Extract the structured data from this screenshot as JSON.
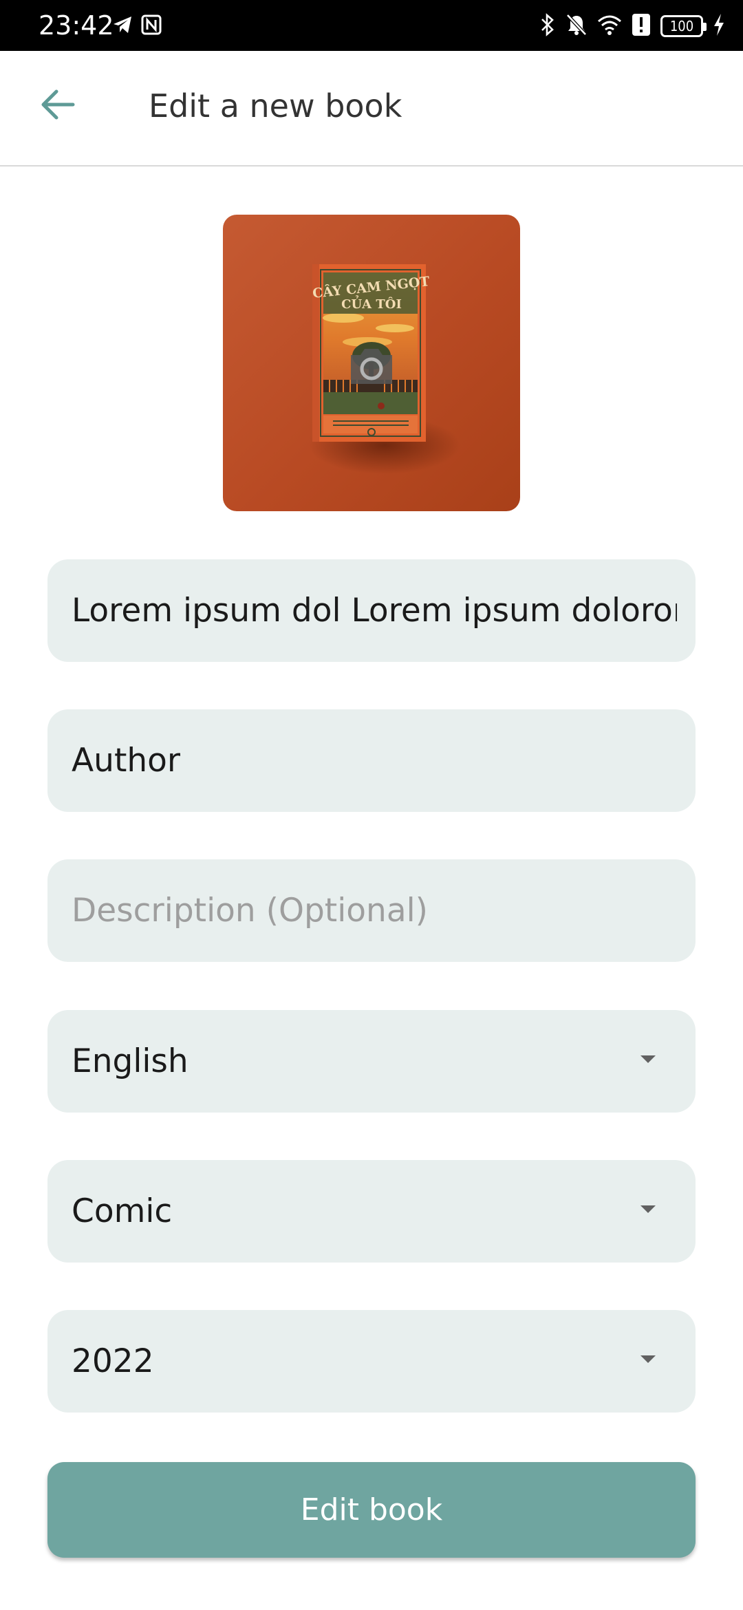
{
  "status_bar": {
    "time": "23:42",
    "battery": "100",
    "left_icons": [
      "telegram-icon",
      "nfc-icon"
    ],
    "right_icons": [
      "bluetooth-icon",
      "bell-off-icon",
      "wifi-icon",
      "alert-icon",
      "battery-icon",
      "charging-icon"
    ]
  },
  "header": {
    "title": "Edit a new book",
    "back_icon": "arrow-left-icon"
  },
  "cover": {
    "book_title_line1": "CÂY CAM NGỌT",
    "book_title_line2": "CỦA TÔI",
    "overlay_icon": "camera-icon",
    "background_color": "#c0522b"
  },
  "form": {
    "title_value": "Lorem ipsum dol Lorem ipsum doloror",
    "author_value": "Author",
    "description_placeholder": "Description (Optional)",
    "language_value": "English",
    "category_value": "Comic",
    "year_value": "2022"
  },
  "submit": {
    "label": "Edit book"
  },
  "colors": {
    "accent": "#6fa5a0",
    "field_bg": "#e8efee",
    "back_arrow": "#5e9a96"
  }
}
